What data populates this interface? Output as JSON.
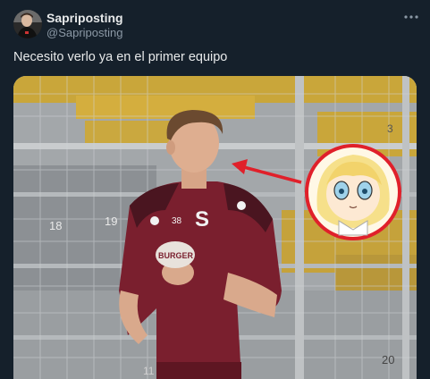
{
  "author": {
    "display_name": "Sapriposting",
    "handle": "@Sapriposting"
  },
  "tweet": {
    "text": "Necesito verlo ya en el primer equipo"
  },
  "photo": {
    "jersey_number": "38",
    "crest_letter": "S",
    "sponsor_text": "BURGER",
    "seat_numbers": [
      "18",
      "19",
      "3",
      "20",
      "11"
    ]
  },
  "icons": {
    "more": "more-horizontal-icon",
    "avatar": "profile-avatar"
  },
  "colors": {
    "background": "#15202b",
    "text_primary": "#e7e9ea",
    "text_secondary": "#8b98a5",
    "jersey": "#7a1f2e",
    "annotation": "#e0202a"
  }
}
